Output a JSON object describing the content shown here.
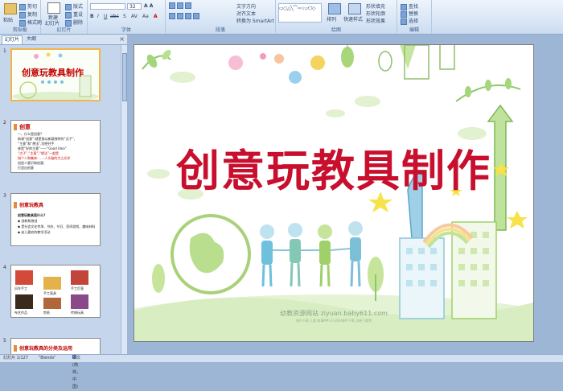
{
  "ribbon": {
    "clipboard": {
      "label": "剪贴板",
      "paste": "粘贴",
      "cut": "剪切",
      "copy": "复制",
      "format_painter": "格式刷"
    },
    "slides": {
      "label": "幻灯片",
      "new_slide": "新建",
      "new_slide2": "幻灯片",
      "layout": "版式",
      "reset": "重设",
      "delete": "删除"
    },
    "font": {
      "label": "字体",
      "font_size": "32"
    },
    "paragraph": {
      "label": "段落",
      "text_direction": "文字方向",
      "align_text": "对齐文本",
      "convert_smartart": "转换为 SmartArt"
    },
    "drawing": {
      "label": "绘图",
      "arrange": "排列",
      "quick_styles": "快速样式",
      "shape_fill": "形状填充",
      "shape_outline": "形状轮廓",
      "shape_effects": "形状效果"
    },
    "editing": {
      "label": "编辑",
      "find": "查找",
      "replace": "替换",
      "select": "选择"
    }
  },
  "panel_tabs": {
    "slides": "幻灯片",
    "outline": "大纲",
    "close": "×"
  },
  "thumbnails": [
    {
      "num": "1",
      "title": "创意玩教具制作"
    },
    {
      "num": "2",
      "title": "创意",
      "lines": [
        "一、什么是创意?",
        "新课“创意”:就是指以新颖独特的“点子”,",
        "“主意”和“想法”,别把并手",
        "来是“好的主意”——“Good Idea”",
        "“点子”,“主意”,“想法”一般是",
        "指个人和集体:……人头脑的力之光学",
        "创造人意识和创意;",
        "打造出创意"
      ]
    },
    {
      "num": "3",
      "title": "创意玩教具",
      "lines": [
        "创意玩教具是什么?",
        "◆ 创新和独创",
        "◆ 是社会文化传承、节庆、节日、民间游戏、趣味材料",
        "◆ 幼儿喜欢的教学活动"
      ]
    },
    {
      "num": "4",
      "captions": [
        "风车手工",
        "手工面具",
        "手工灯笼",
        "布艺作品",
        "剪纸",
        "传统玩具"
      ]
    },
    {
      "num": "5",
      "title": "创意玩教具的分类及运用"
    }
  ],
  "slide": {
    "title": "创意玩教具制作",
    "watermark": "幼教资源网站 ziyuan.baby611.com",
    "watermark_sub": "课件下载  儿歌  故事MP3  FLASH课件下载  试卷下载等"
  },
  "status": {
    "slide_info": "幻灯片 1/127",
    "theme": "\"Blends\"",
    "language": "中文(简体，中国)"
  },
  "colors": {
    "title_red": "#c8102e",
    "ribbon_blue": "#d9e6f5",
    "selection_orange": "#f3b54a"
  }
}
